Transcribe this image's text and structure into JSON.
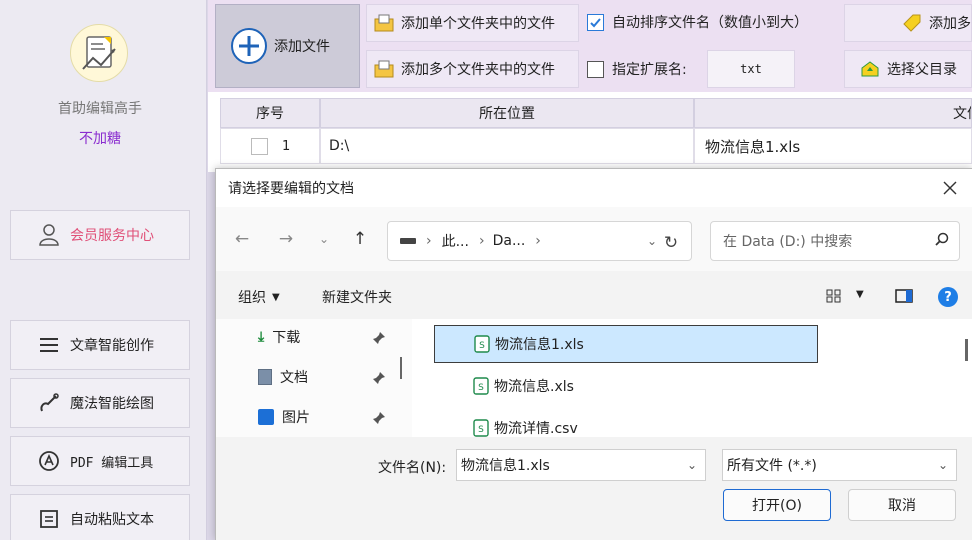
{
  "sidebar": {
    "app_name": "首助编辑高手",
    "slogan": "不加糖",
    "member_label": "会员服务中心",
    "items": [
      {
        "label": "文章智能创作",
        "icon": "list-icon"
      },
      {
        "label": "魔法智能绘图",
        "icon": "magic-wand-icon"
      },
      {
        "label": "PDF 编辑工具",
        "icon": "pdf-icon"
      },
      {
        "label": "自动粘贴文本",
        "icon": "clipboard-icon"
      }
    ]
  },
  "toolbar": {
    "add_file": "添加文件",
    "add_single_folder": "添加单个文件夹中的文件",
    "add_multi_folder": "添加多个文件夹中的文件",
    "auto_sort_label": "自动排序文件名（数值小到大）",
    "auto_sort_checked": true,
    "ext_label": "指定扩展名:",
    "ext_checked": false,
    "ext_value": "txt",
    "add_more_partial": "添加多",
    "choose_parent": "选择父目录"
  },
  "table": {
    "headers": [
      "序号",
      "所在位置",
      "文件"
    ],
    "rows": [
      {
        "index": "1",
        "location": "D:\\",
        "name": "物流信息1.xls"
      }
    ]
  },
  "dialog": {
    "title": "请选择要编辑的文档",
    "address": {
      "crumb1": "此...",
      "crumb2": "Da..."
    },
    "search_placeholder": "在 Data (D:) 中搜索",
    "organize": "组织",
    "new_folder": "新建文件夹",
    "nav_items": [
      "下载",
      "文档",
      "图片"
    ],
    "files": [
      "物流信息1.xls",
      "物流信息.xls",
      "物流详情.csv"
    ],
    "filename_label": "文件名(N):",
    "filename_value": "物流信息1.xls",
    "filetype_value": "所有文件 (*.*)",
    "open": "打开(O)",
    "cancel": "取消"
  },
  "colors": {
    "accent": "#2a7ad8",
    "slogan": "#8a2ccf",
    "member": "#e05078",
    "selection": "#cce8ff"
  }
}
